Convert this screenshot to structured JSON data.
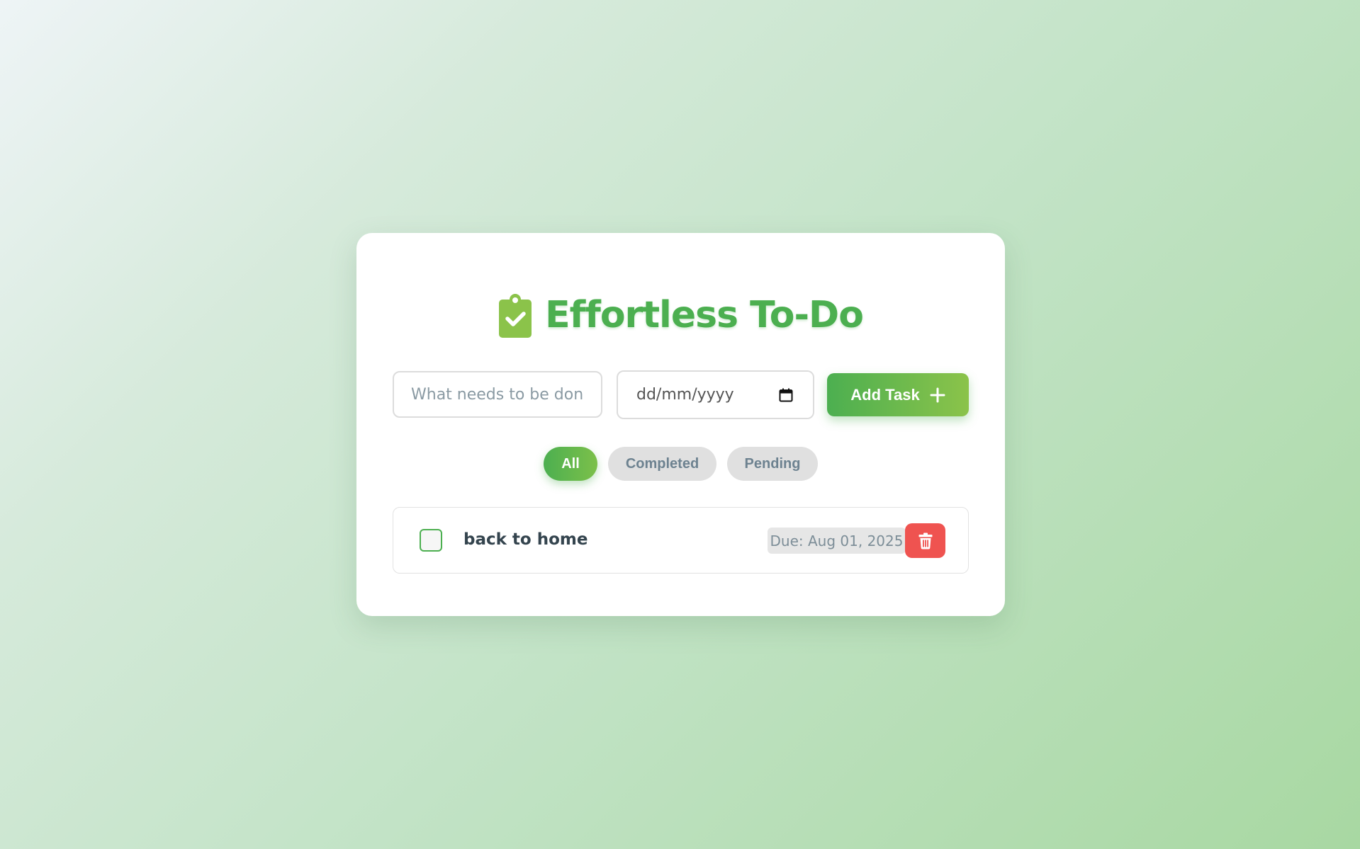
{
  "app": {
    "title": "Effortless To-Do",
    "icon": "clipboard-check-icon",
    "colors": {
      "primary": "#4caf50",
      "secondary": "#8bc34a",
      "danger": "#ef5350"
    }
  },
  "form": {
    "task_placeholder": "What needs to be done",
    "task_value": "",
    "date_placeholder": "dd/mm/yyyy",
    "date_icon": "calendar-icon",
    "add_label": "Add Task",
    "add_icon": "plus-icon"
  },
  "filters": {
    "items": [
      {
        "label": "All",
        "active": true
      },
      {
        "label": "Completed",
        "active": false
      },
      {
        "label": "Pending",
        "active": false
      }
    ]
  },
  "tasks": [
    {
      "text": "back to home",
      "completed": false,
      "due": "Due: Aug 01, 2025",
      "delete_icon": "trash-icon"
    }
  ]
}
